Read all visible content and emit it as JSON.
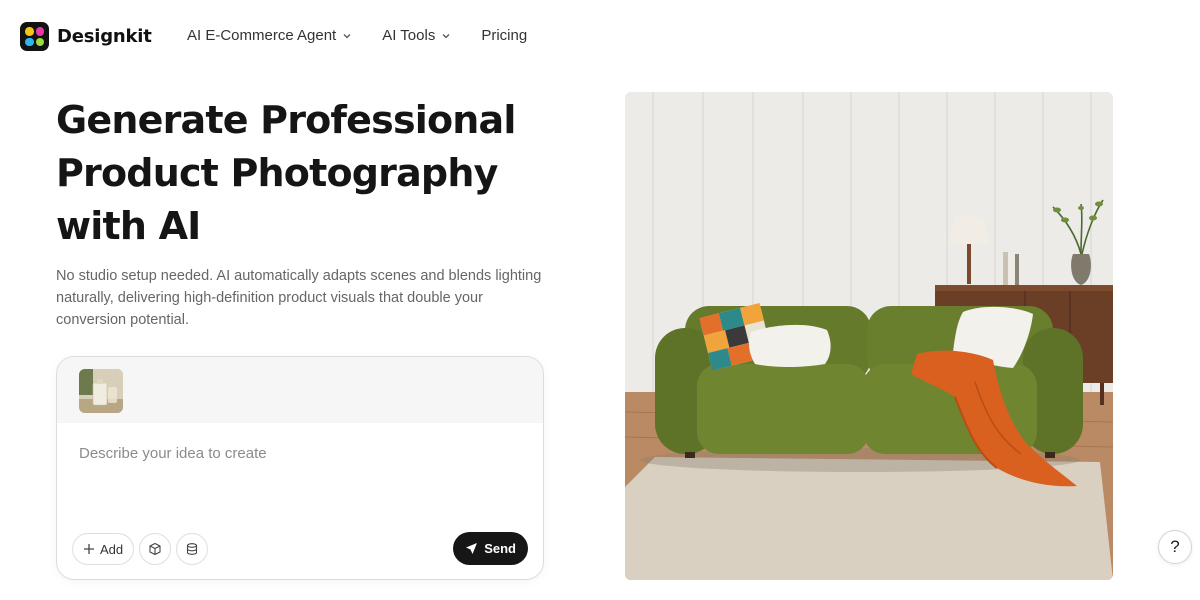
{
  "brand": {
    "name": "Designkit",
    "logo_colors": [
      "#f5c518",
      "#e63aa3",
      "#2fb8f0",
      "#9adf3a"
    ]
  },
  "nav": {
    "items": [
      {
        "label": "AI E-Commerce Agent",
        "has_dropdown": true
      },
      {
        "label": "AI Tools",
        "has_dropdown": true
      },
      {
        "label": "Pricing",
        "has_dropdown": false
      }
    ]
  },
  "hero": {
    "title_lines": [
      "Generate Professional",
      "Product Photography",
      "with AI"
    ],
    "subtitle": "No studio setup needed. AI automatically adapts scenes and blends lighting naturally, delivering high-definition product visuals that double your conversion potential."
  },
  "prompt": {
    "placeholder": "Describe your idea to create",
    "value": "",
    "add_label": "Add",
    "send_label": "Send",
    "tool_icons": [
      "plus-icon",
      "cube-icon",
      "stack-icon"
    ]
  },
  "help": {
    "label": "?"
  },
  "colors": {
    "primary_dark": "#161616",
    "sofa_green": "#6a7f2e",
    "throw_orange": "#d9601f"
  }
}
